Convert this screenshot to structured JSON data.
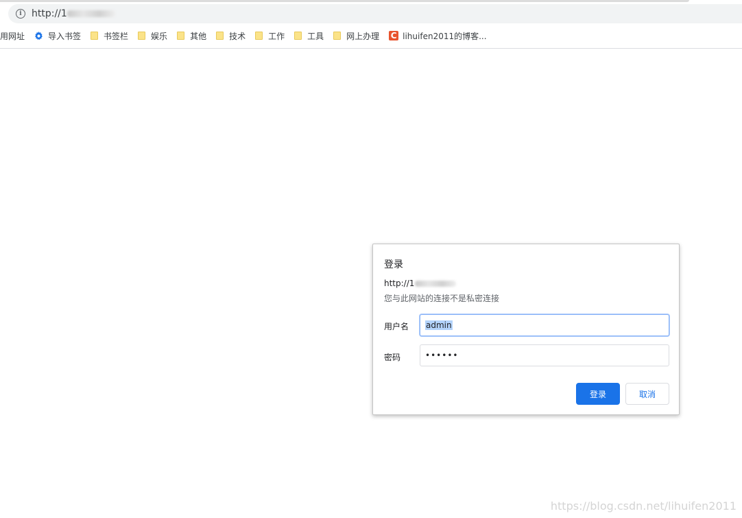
{
  "address_bar": {
    "url_prefix": "http://1"
  },
  "bookmarks": [
    {
      "label": "用网址",
      "icon": "none"
    },
    {
      "label": "导入书签",
      "icon": "gear-icon"
    },
    {
      "label": "书签栏",
      "icon": "folder-icon"
    },
    {
      "label": "娱乐",
      "icon": "folder-icon"
    },
    {
      "label": "其他",
      "icon": "folder-icon"
    },
    {
      "label": "技术",
      "icon": "folder-icon"
    },
    {
      "label": "工作",
      "icon": "folder-icon"
    },
    {
      "label": "工具",
      "icon": "folder-icon"
    },
    {
      "label": "网上办理",
      "icon": "folder-icon"
    },
    {
      "label": "lihuifen2011的博客...",
      "icon": "csdn-icon",
      "icon_text": "C"
    }
  ],
  "dialog": {
    "title": "登录",
    "url": "http://1",
    "warning": "您与此网站的连接不是私密连接",
    "username_label": "用户名",
    "username_value": "admin",
    "password_label": "密码",
    "password_masked": "••••••",
    "login_button": "登录",
    "cancel_button": "取消"
  },
  "watermark": "https://blog.csdn.net/lihuifen2011",
  "colors": {
    "primary": "#1a73e8",
    "focus": "#8ab4f8",
    "selection": "#b3d3fb",
    "folder": "#fbe389",
    "csdn": "#e8542e"
  }
}
